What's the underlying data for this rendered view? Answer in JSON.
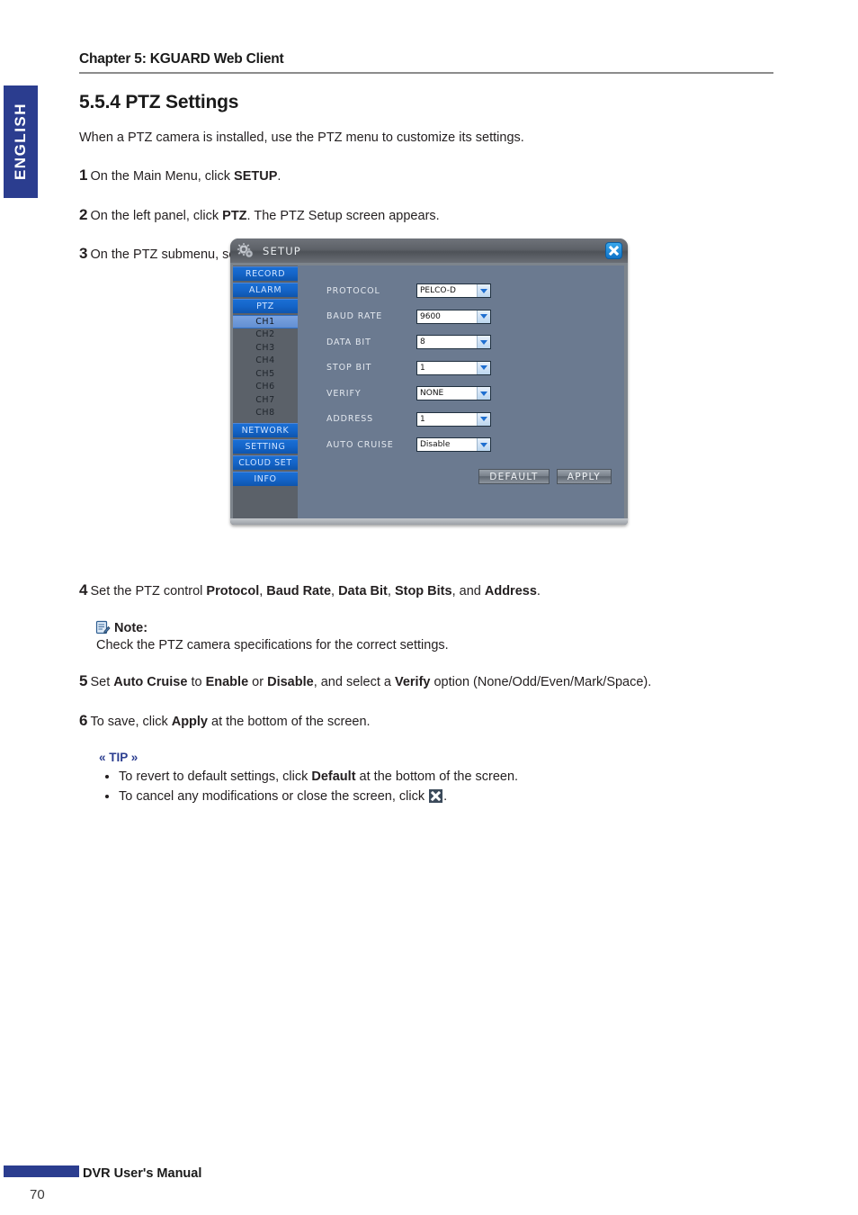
{
  "language_tab": {
    "label": "ENGLISH"
  },
  "header": {
    "chapter": "Chapter 5: KGUARD Web Client",
    "section_title": "5.5.4 PTZ Settings"
  },
  "body": {
    "intro": "When a PTZ camera is installed, use the PTZ menu to customize its settings.",
    "steps": [
      {
        "num": "1",
        "html": "On the Main Menu, click <b>SETUP</b>."
      },
      {
        "num": "2",
        "html": "On the left panel, click <b>PTZ</b>. The PTZ Setup screen appears."
      },
      {
        "num": "3",
        "html": "On the PTZ submenu, select the channel where the PTZ camera is installed."
      },
      {
        "num": "4",
        "html": "Set the PTZ control <b>Protocol</b>, <b>Baud Rate</b>, <b>Data Bit</b>, <b>Stop Bits</b>, and <b>Address</b>."
      },
      {
        "num": "5",
        "html": "Set <b>Auto Cruise</b> to <b>Enable</b> or <b>Disable</b>, and select a <b>Verify</b> option (None/Odd/Even/Mark/Space)."
      },
      {
        "num": "6",
        "html": "To save, click <b>Apply</b> at the bottom of the screen."
      }
    ]
  },
  "note": {
    "icon": "notepad-pencil-icon",
    "label": "Note:",
    "text": "Check the PTZ camera specifications for the correct settings."
  },
  "tip": {
    "title": "« TIP »",
    "items": [
      {
        "prefix": "To revert to default settings, click ",
        "bold": "Default",
        "suffix": " at the bottom of the screen.",
        "icon": false
      },
      {
        "prefix": "To cancel any modifications or close the screen, click ",
        "bold": "",
        "suffix": ".",
        "icon": true
      }
    ]
  },
  "dialog": {
    "title": "SETUP",
    "gear_icon": "gear-icon",
    "close_icon": "close-icon",
    "sidebar": [
      {
        "label": "RECORD",
        "type": "main",
        "active": false
      },
      {
        "label": "ALARM",
        "type": "main",
        "active": false
      },
      {
        "label": "PTZ",
        "type": "main",
        "active": false
      },
      {
        "label": "CH1",
        "type": "channel",
        "active": true
      },
      {
        "label": "CH2",
        "type": "channel",
        "active": false
      },
      {
        "label": "CH3",
        "type": "channel",
        "active": false
      },
      {
        "label": "CH4",
        "type": "channel",
        "active": false
      },
      {
        "label": "CH5",
        "type": "channel",
        "active": false
      },
      {
        "label": "CH6",
        "type": "channel",
        "active": false
      },
      {
        "label": "CH7",
        "type": "channel",
        "active": false
      },
      {
        "label": "CH8",
        "type": "channel",
        "active": false
      },
      {
        "label": "NETWORK",
        "type": "main",
        "active": false
      },
      {
        "label": "SETTING",
        "type": "main",
        "active": false
      },
      {
        "label": "CLOUD SET",
        "type": "main",
        "active": false
      },
      {
        "label": "INFO",
        "type": "main",
        "active": false
      }
    ],
    "fields": [
      {
        "label": "PROTOCOL",
        "value": "PELCO-D"
      },
      {
        "label": "BAUD RATE",
        "value": "9600"
      },
      {
        "label": "DATA BIT",
        "value": "8"
      },
      {
        "label": "STOP BIT",
        "value": "1"
      },
      {
        "label": "VERIFY",
        "value": "NONE"
      },
      {
        "label": "ADDRESS",
        "value": "1"
      },
      {
        "label": "AUTO CRUISE",
        "value": "Disable"
      }
    ],
    "buttons": [
      {
        "label": "DEFAULT"
      },
      {
        "label": "APPLY"
      }
    ],
    "colors": {
      "sidebar_blue": "#1464c8",
      "active_channel": "#6b95d8",
      "panel": "#6b7a90",
      "close_blue": "#1f8fdd"
    }
  },
  "footer": {
    "manual_title": "DVR User's Manual",
    "page_number": "70"
  }
}
